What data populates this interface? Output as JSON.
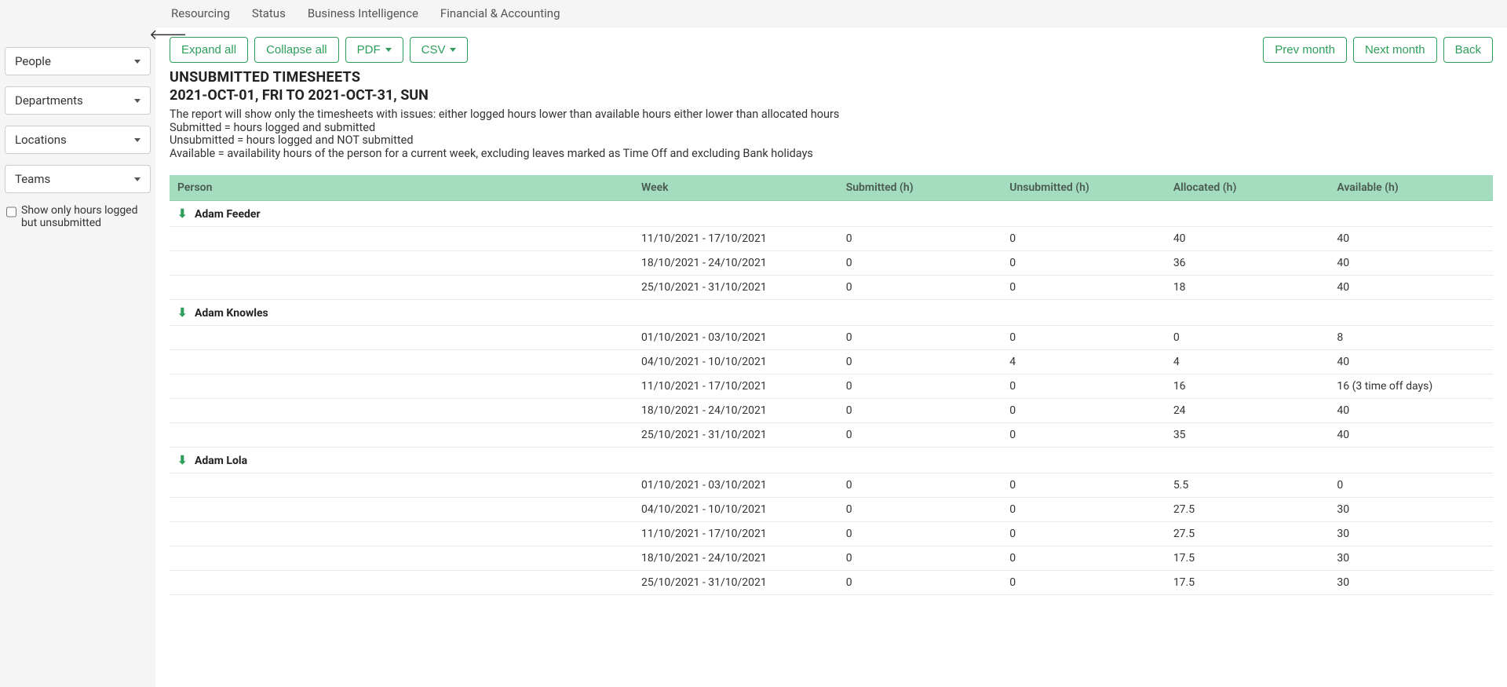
{
  "topnav": [
    {
      "label": "Resourcing"
    },
    {
      "label": "Status"
    },
    {
      "label": "Business Intelligence"
    },
    {
      "label": "Financial & Accounting"
    }
  ],
  "sidebar": {
    "filters": [
      {
        "label": "People"
      },
      {
        "label": "Departments"
      },
      {
        "label": "Locations"
      },
      {
        "label": "Teams"
      }
    ],
    "checkbox_label": "Show only hours logged but unsubmitted"
  },
  "toolbar": {
    "expand_all": "Expand all",
    "collapse_all": "Collapse all",
    "pdf": "PDF",
    "csv": "CSV",
    "prev_month": "Prev month",
    "next_month": "Next month",
    "back": "Back"
  },
  "title": "UNSUBMITTED TIMESHEETS",
  "date_range": "2021-OCT-01, FRI TO 2021-OCT-31, SUN",
  "description_lines": [
    "The report will show only the timesheets with issues: either logged hours lower than available hours either lower than allocated hours",
    "Submitted = hours logged and submitted",
    "Unsubmitted = hours logged and NOT submitted",
    "Available = availability hours of the person for a current week, excluding leaves marked as Time Off and excluding Bank holidays"
  ],
  "columns": {
    "person": "Person",
    "week": "Week",
    "submitted": "Submitted (h)",
    "unsubmitted": "Unsubmitted (h)",
    "allocated": "Allocated (h)",
    "available": "Available (h)"
  },
  "groups": [
    {
      "name": "Adam Feeder",
      "rows": [
        {
          "week": "11/10/2021 - 17/10/2021",
          "submitted": "0",
          "unsubmitted": "0",
          "allocated": "40",
          "available": "40"
        },
        {
          "week": "18/10/2021 - 24/10/2021",
          "submitted": "0",
          "unsubmitted": "0",
          "allocated": "36",
          "available": "40"
        },
        {
          "week": "25/10/2021 - 31/10/2021",
          "submitted": "0",
          "unsubmitted": "0",
          "allocated": "18",
          "available": "40"
        }
      ]
    },
    {
      "name": "Adam Knowles",
      "rows": [
        {
          "week": "01/10/2021 - 03/10/2021",
          "submitted": "0",
          "unsubmitted": "0",
          "allocated": "0",
          "available": "8"
        },
        {
          "week": "04/10/2021 - 10/10/2021",
          "submitted": "0",
          "unsubmitted": "4",
          "allocated": "4",
          "available": "40"
        },
        {
          "week": "11/10/2021 - 17/10/2021",
          "submitted": "0",
          "unsubmitted": "0",
          "allocated": "16",
          "available": "16 (3 time off days)"
        },
        {
          "week": "18/10/2021 - 24/10/2021",
          "submitted": "0",
          "unsubmitted": "0",
          "allocated": "24",
          "available": "40"
        },
        {
          "week": "25/10/2021 - 31/10/2021",
          "submitted": "0",
          "unsubmitted": "0",
          "allocated": "35",
          "available": "40"
        }
      ]
    },
    {
      "name": "Adam Lola",
      "rows": [
        {
          "week": "01/10/2021 - 03/10/2021",
          "submitted": "0",
          "unsubmitted": "0",
          "allocated": "5.5",
          "available": "0"
        },
        {
          "week": "04/10/2021 - 10/10/2021",
          "submitted": "0",
          "unsubmitted": "0",
          "allocated": "27.5",
          "available": "30"
        },
        {
          "week": "11/10/2021 - 17/10/2021",
          "submitted": "0",
          "unsubmitted": "0",
          "allocated": "27.5",
          "available": "30"
        },
        {
          "week": "18/10/2021 - 24/10/2021",
          "submitted": "0",
          "unsubmitted": "0",
          "allocated": "17.5",
          "available": "30"
        },
        {
          "week": "25/10/2021 - 31/10/2021",
          "submitted": "0",
          "unsubmitted": "0",
          "allocated": "17.5",
          "available": "30"
        }
      ]
    }
  ]
}
